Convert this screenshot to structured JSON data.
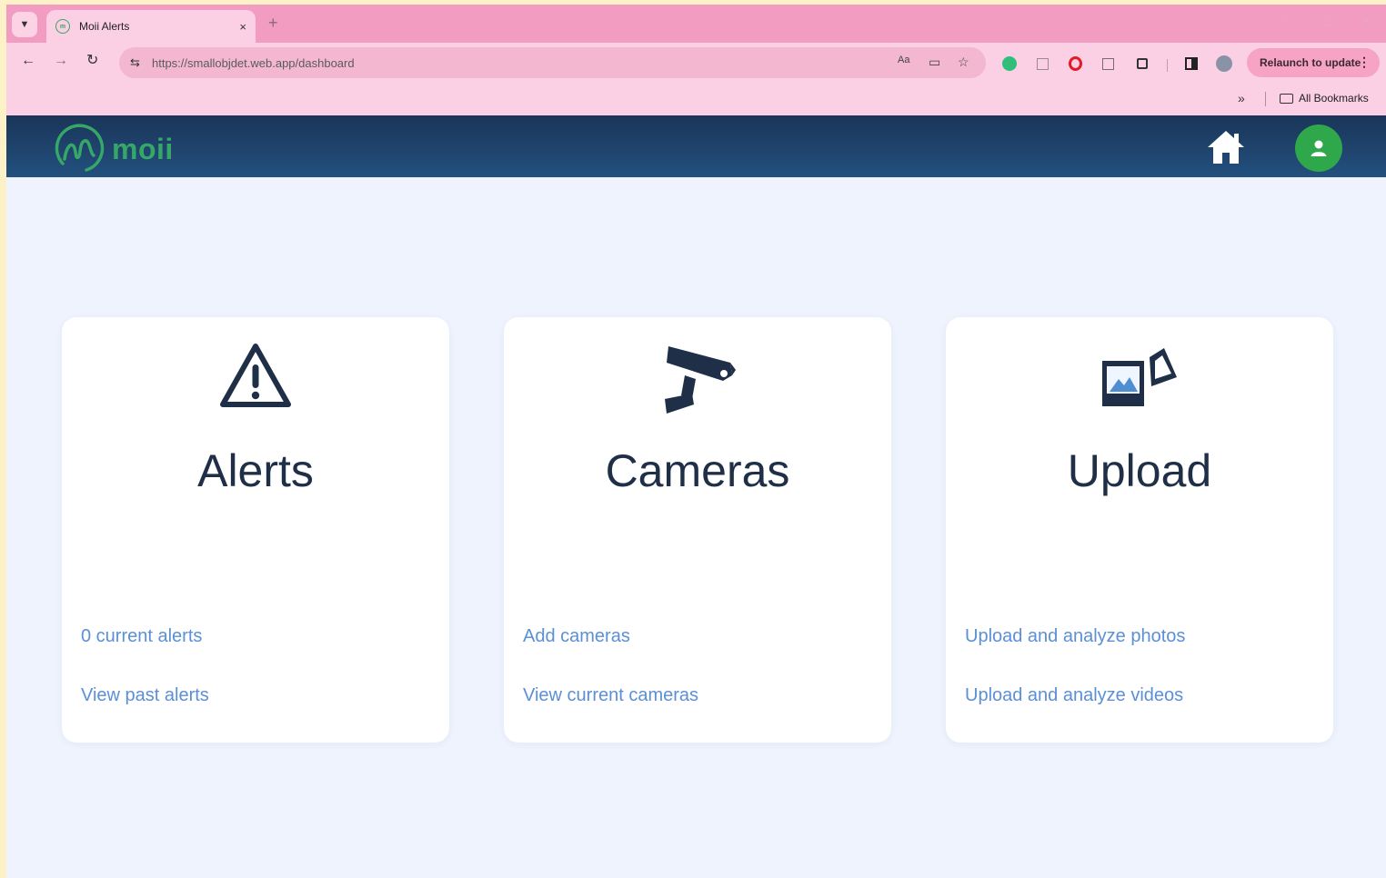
{
  "browser": {
    "tab_title": "Moii Alerts",
    "tab_close": "×",
    "new_tab": "+",
    "url": "https://smallobjdet.web.app/dashboard",
    "relaunch_label": "Relaunch to update",
    "relaunch_menu": "⋮",
    "bookmarks_overflow": "»",
    "bookmarks_all": "All Bookmarks",
    "window_controls": [
      "–",
      "▢",
      "✕"
    ]
  },
  "app": {
    "logo_text": "moii",
    "colors": {
      "header_from": "#1a3558",
      "header_to": "#23507f",
      "logo": "#35a868",
      "avatar": "#2ea84a",
      "link": "#5b8fd6",
      "title": "#1f2f47"
    }
  },
  "cards": [
    {
      "title": "Alerts",
      "icon": "warning-icon",
      "links": [
        "0 current alerts",
        "View past alerts"
      ]
    },
    {
      "title": "Cameras",
      "icon": "security-camera-icon",
      "links": [
        "Add cameras",
        "View current cameras"
      ]
    },
    {
      "title": "Upload",
      "icon": "photos-upload-icon",
      "links": [
        "Upload and analyze photos",
        "Upload and analyze videos"
      ]
    }
  ]
}
